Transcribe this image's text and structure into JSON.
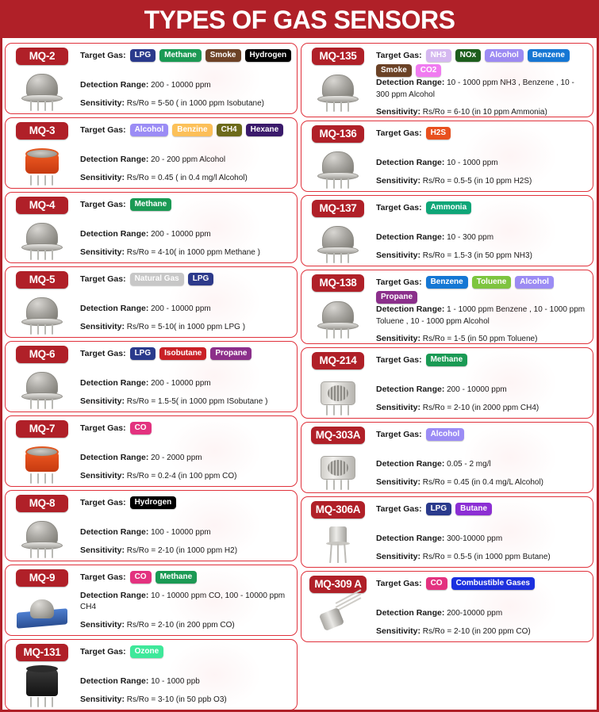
{
  "header": {
    "title": "TYPES OF GAS SENSORS"
  },
  "labels": {
    "target_gas": "Target Gas:",
    "detection_range": "Detection Range:",
    "sensitivity": "Sensitivity:"
  },
  "colors": {
    "brand_red": "#b02028",
    "card_border": "#e0323c",
    "badge_lpg": "#2a3a8c",
    "badge_methane": "#1a9a54",
    "badge_smoke": "#6b4226",
    "badge_hydrogen": "#000000",
    "badge_alcohol": "#9b8cf5",
    "badge_benzine": "#fcc159",
    "badge_ch4": "#6b6b1a",
    "badge_hexane": "#3a1a6b",
    "badge_natural_gas": "#c7c7c7",
    "badge_isobutane": "#c92026",
    "badge_propane": "#8b2f8b",
    "badge_co": "#e3327f",
    "badge_ozone": "#3ee89a",
    "badge_nh3": "#d5b8f0",
    "badge_nox": "#1d5e1d",
    "badge_benzene": "#1577d4",
    "badge_co2": "#f07bf0",
    "badge_h2s": "#e8501e",
    "badge_ammonia": "#0fa678",
    "badge_toluene": "#7dc63f",
    "badge_butane": "#8b2fd4",
    "badge_combustible": "#1a30e0"
  },
  "left_column": [
    {
      "model": "MQ-2",
      "image": "mesh-dome-sensor-icon",
      "gases": [
        {
          "name": "LPG",
          "color": "#2a3a8c",
          "text": "#ffffff"
        },
        {
          "name": "Methane",
          "color": "#1a9a54",
          "text": "#ffffff"
        },
        {
          "name": "Smoke",
          "color": "#6b4226",
          "text": "#ffffff"
        },
        {
          "name": "Hydrogen",
          "color": "#000000",
          "text": "#ffffff"
        }
      ],
      "detection_range": "200 - 10000 ppm",
      "sensitivity": "Rs/Ro = 5-50 ( in 1000 ppm Isobutane)"
    },
    {
      "model": "MQ-3",
      "image": "orange-can-sensor-icon",
      "gases": [
        {
          "name": "Alcohol",
          "color": "#9b8cf5",
          "text": "#ffffff"
        },
        {
          "name": "Benzine",
          "color": "#fcc159",
          "text": "#ffffff"
        },
        {
          "name": "CH4",
          "color": "#6b6b1a",
          "text": "#ffffff"
        },
        {
          "name": "Hexane",
          "color": "#3a1a6b",
          "text": "#ffffff"
        }
      ],
      "detection_range": "20 - 200 ppm  Alcohol",
      "sensitivity": "Rs/Ro = 0.45 ( in 0.4 mg/l Alcohol)"
    },
    {
      "model": "MQ-4",
      "image": "mesh-dome-sensor-icon",
      "gases": [
        {
          "name": "Methane",
          "color": "#1a9a54",
          "text": "#ffffff"
        }
      ],
      "detection_range": "200 - 10000 ppm",
      "sensitivity": "Rs/Ro = 4-10( in 1000 ppm Methane )"
    },
    {
      "model": "MQ-5",
      "image": "mesh-dome-sensor-icon",
      "gases": [
        {
          "name": "Natural Gas",
          "color": "#c7c7c7",
          "text": "#ffffff"
        },
        {
          "name": "LPG",
          "color": "#2a3a8c",
          "text": "#ffffff"
        }
      ],
      "detection_range": "200 - 10000 ppm",
      "sensitivity": "Rs/Ro = 5-10( in 1000 ppm LPG )"
    },
    {
      "model": "MQ-6",
      "image": "mesh-dome-sensor-icon",
      "gases": [
        {
          "name": "LPG",
          "color": "#2a3a8c",
          "text": "#ffffff"
        },
        {
          "name": "Isobutane",
          "color": "#c92026",
          "text": "#ffffff"
        },
        {
          "name": "Propane",
          "color": "#8b2f8b",
          "text": "#ffffff"
        }
      ],
      "detection_range": "200 - 10000 ppm",
      "sensitivity": "Rs/Ro = 1.5-5( in 1000 ppm ISobutane )"
    },
    {
      "model": "MQ-7",
      "image": "orange-can-sensor-icon",
      "gases": [
        {
          "name": "CO",
          "color": "#e3327f",
          "text": "#ffffff"
        }
      ],
      "detection_range": "20 - 2000 ppm",
      "sensitivity": "Rs/Ro = 0.2-4 (in 100 ppm CO)"
    },
    {
      "model": "MQ-8",
      "image": "mesh-dome-sensor-icon",
      "gases": [
        {
          "name": "Hydrogen",
          "color": "#000000",
          "text": "#ffffff"
        }
      ],
      "detection_range": "100 - 10000 ppm",
      "sensitivity": "Rs/Ro = 2-10 (in 1000 ppm H2)"
    },
    {
      "model": "MQ-9",
      "image": "blue-pcb-module-icon",
      "gases": [
        {
          "name": "CO",
          "color": "#e3327f",
          "text": "#ffffff"
        },
        {
          "name": "Methane",
          "color": "#1a9a54",
          "text": "#ffffff"
        }
      ],
      "detection_range": "10 - 10000 ppm CO, 100 - 10000 ppm CH4",
      "sensitivity": "Rs/Ro = 2-10 (in 200 ppm CO)"
    },
    {
      "model": "MQ-131",
      "image": "black-puck-sensor-icon",
      "gases": [
        {
          "name": "Ozone",
          "color": "#3ee89a",
          "text": "#ffffff"
        }
      ],
      "detection_range": "10 - 1000 ppb",
      "sensitivity": "Rs/Ro = 3-10 (in 50 ppb O3)"
    }
  ],
  "right_column": [
    {
      "model": "MQ-135",
      "image": "mesh-dome-sensor-icon",
      "gases": [
        {
          "name": "NH3",
          "color": "#d5b8f0",
          "text": "#ffffff"
        },
        {
          "name": "NOx",
          "color": "#1d5e1d",
          "text": "#ffffff"
        },
        {
          "name": "Alcohol",
          "color": "#9b8cf5",
          "text": "#ffffff"
        },
        {
          "name": "Benzene",
          "color": "#1577d4",
          "text": "#ffffff"
        },
        {
          "name": "Smoke",
          "color": "#6b4226",
          "text": "#ffffff"
        },
        {
          "name": "CO2",
          "color": "#f07bf0",
          "text": "#ffffff"
        }
      ],
      "detection_range": "10 - 1000 ppm NH3 , Benzene , 10 - 300 ppm Alcohol",
      "sensitivity": "Rs/Ro = 6-10 (in 10 ppm Ammonia)"
    },
    {
      "model": "MQ-136",
      "image": "mesh-dome-sensor-icon",
      "gases": [
        {
          "name": "H2S",
          "color": "#e8501e",
          "text": "#ffffff"
        }
      ],
      "detection_range": "10 - 1000 ppm",
      "sensitivity": "Rs/Ro = 0.5-5 (in 10 ppm H2S)"
    },
    {
      "model": "MQ-137",
      "image": "mesh-dome-sensor-icon",
      "gases": [
        {
          "name": "Ammonia",
          "color": "#0fa678",
          "text": "#ffffff"
        }
      ],
      "detection_range": "10 - 300 ppm",
      "sensitivity": "Rs/Ro = 1.5-3 (in 50 ppm NH3)"
    },
    {
      "model": "MQ-138",
      "image": "mesh-dome-sensor-icon",
      "gases": [
        {
          "name": "Benzene",
          "color": "#1577d4",
          "text": "#ffffff"
        },
        {
          "name": "Toluene",
          "color": "#7dc63f",
          "text": "#ffffff"
        },
        {
          "name": "Alcohol",
          "color": "#9b8cf5",
          "text": "#ffffff"
        },
        {
          "name": "Propane",
          "color": "#8b2f8b",
          "text": "#ffffff"
        }
      ],
      "detection_range": "1 - 1000 ppm Benzene , 10 - 1000 ppm Toluene , 10 - 1000 ppm Alcohol",
      "sensitivity": "Rs/Ro = 1-5 (in 50 ppm Toluene)"
    },
    {
      "model": "MQ-214",
      "image": "metal-can-sensor-icon",
      "gases": [
        {
          "name": "Methane",
          "color": "#1a9a54",
          "text": "#ffffff"
        }
      ],
      "detection_range": "200 - 10000 ppm",
      "sensitivity": "Rs/Ro = 2-10 (in 2000 ppm CH4)"
    },
    {
      "model": "MQ-303A",
      "image": "metal-can-sensor-icon",
      "gases": [
        {
          "name": "Alcohol",
          "color": "#9b8cf5",
          "text": "#ffffff"
        }
      ],
      "detection_range": "0.05 - 2 mg/l",
      "sensitivity": "Rs/Ro = 0.45 (in 0.4 mg/L Alcohol)"
    },
    {
      "model": "MQ-306A",
      "image": "to5-can-sensor-icon",
      "gases": [
        {
          "name": "LPG",
          "color": "#2a3a8c",
          "text": "#ffffff"
        },
        {
          "name": "Butane",
          "color": "#8b2fd4",
          "text": "#ffffff"
        }
      ],
      "detection_range": "300-10000 ppm",
      "sensitivity": "Rs/Ro = 0.5-5 (in 1000 ppm Butane)"
    },
    {
      "model": "MQ-309 A",
      "image": "angled-can-sensor-icon",
      "gases": [
        {
          "name": "CO",
          "color": "#e3327f",
          "text": "#ffffff"
        },
        {
          "name": "Combustible Gases",
          "color": "#1a30e0",
          "text": "#ffffff"
        }
      ],
      "detection_range": "200-10000 ppm",
      "sensitivity": "Rs/Ro = 2-10 (in 200 ppm CO)"
    }
  ]
}
